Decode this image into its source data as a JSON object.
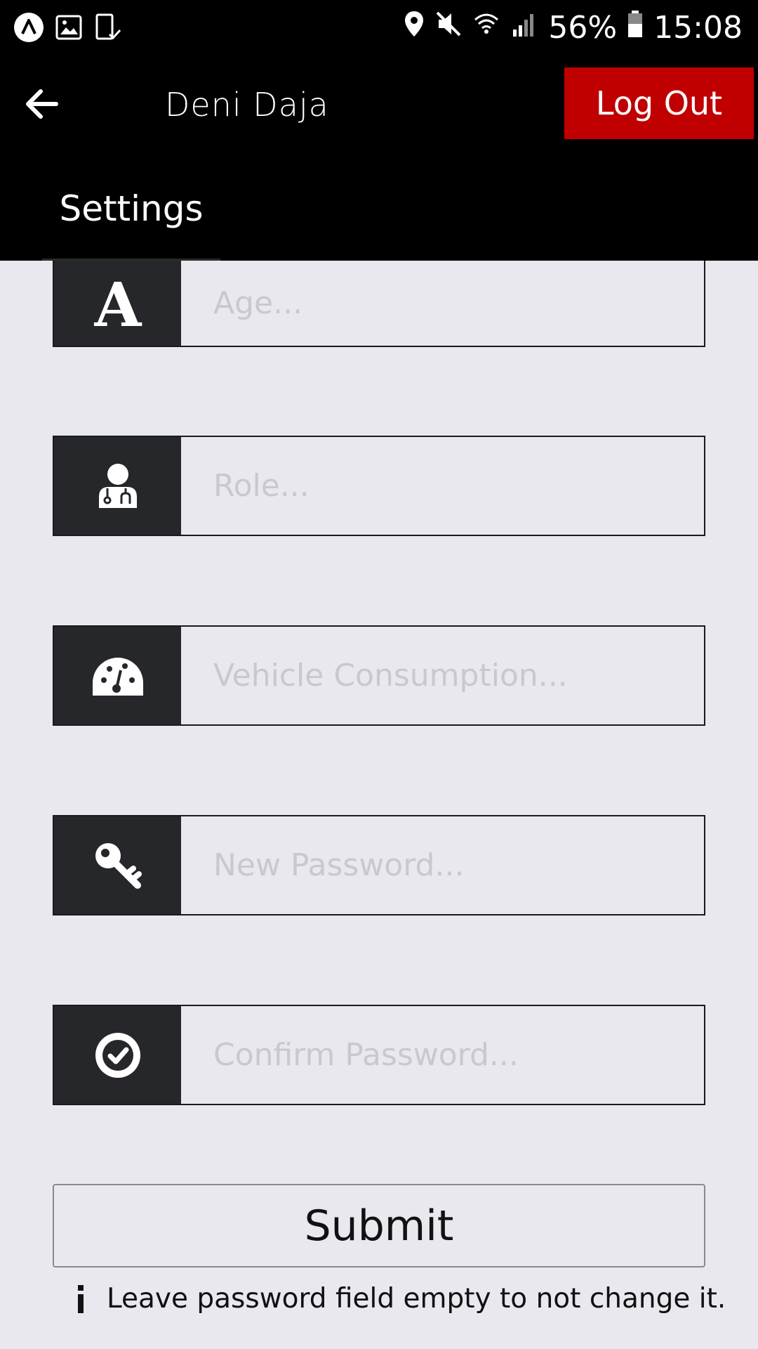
{
  "status_bar": {
    "battery": "56%",
    "time": "15:08"
  },
  "header": {
    "user_name": "Deni Daja",
    "logout_label": "Log Out",
    "tab_label": "Settings"
  },
  "form": {
    "age_placeholder": "Age...",
    "role_placeholder": "Role...",
    "consumption_placeholder": "Vehicle Consumption...",
    "new_password_placeholder": "New Password...",
    "confirm_password_placeholder": "Confirm Password...",
    "submit_label": "Submit",
    "hint_text": "Leave password field empty to not change it."
  },
  "colors": {
    "accent": "#c00000",
    "header_bg": "#000000",
    "page_bg": "#e9e8ef",
    "icon_box": "#26272a"
  }
}
